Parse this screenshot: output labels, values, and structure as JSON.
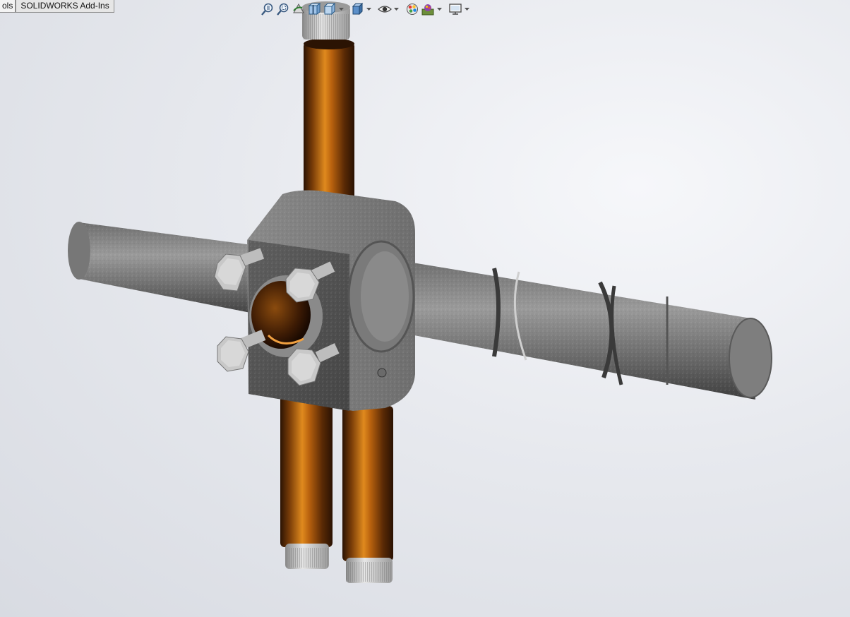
{
  "command_manager": {
    "tabs": [
      {
        "label": "ols"
      },
      {
        "label": "SOLIDWORKS Add-Ins"
      }
    ]
  },
  "heads_up_toolbar": {
    "buttons": [
      {
        "icon": "zoom-to-fit-icon"
      },
      {
        "icon": "zoom-to-area-icon"
      },
      {
        "icon": "previous-view-icon"
      },
      {
        "icon": "section-view-icon"
      },
      {
        "icon": "view-orientation-icon"
      },
      {
        "icon": "display-style-icon"
      },
      {
        "icon": "hide-show-items-icon"
      },
      {
        "icon": "edit-appearance-icon"
      },
      {
        "icon": "apply-scene-icon"
      },
      {
        "icon": "view-settings-icon"
      }
    ]
  },
  "colors": {
    "steel": "#8e8e8e",
    "steel_dark": "#4e4e4e",
    "bronze": "#b0600c",
    "bronze_dark": "#3a1a04",
    "bolt": "#c9c9c9",
    "knurl": "#d0d0d0"
  }
}
